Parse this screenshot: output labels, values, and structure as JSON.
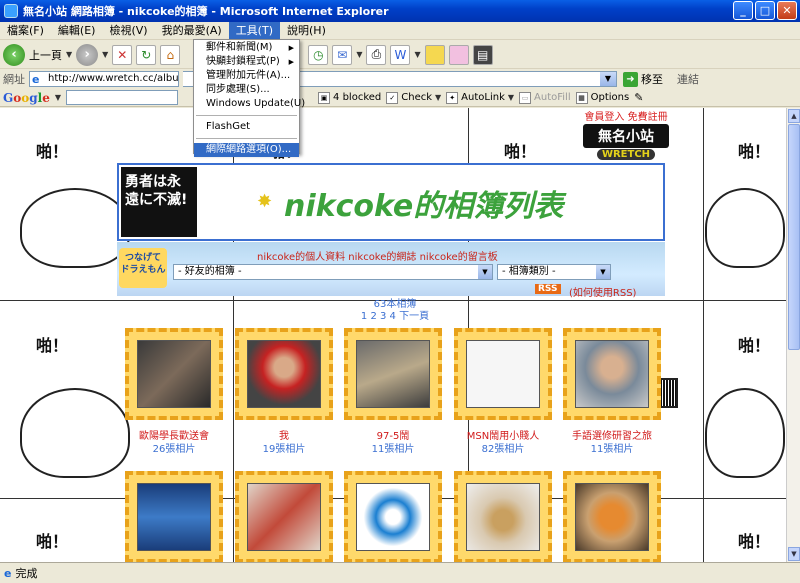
{
  "window": {
    "title": "無名小站 網路相簿 - nikcoke的相簿 - Microsoft Internet Explorer"
  },
  "menu": [
    "檔案(F)",
    "編輯(E)",
    "檢視(V)",
    "我的最愛(A)",
    "工具(T)",
    "說明(H)"
  ],
  "toolbar": {
    "back_label": "上一頁"
  },
  "address": {
    "label": "網址",
    "url": "http://www.wretch.cc/album/nikcoke",
    "go_label": "移至",
    "links_label": "連結"
  },
  "google_bar": {
    "logo": "Google",
    "blocked": "4 blocked",
    "check": "Check",
    "autolink": "AutoLink",
    "autofill": "AutoFill",
    "options": "Options"
  },
  "tools_menu": {
    "items": [
      "郵件和新聞(M)",
      "快顯封鎖程式(P)",
      "管理附加元件(A)...",
      "同步處理(S)...",
      "Windows Update(U)"
    ],
    "flashget": "FlashGet",
    "internet_options": "網際網路選項(O)..."
  },
  "page": {
    "papa": "啪！",
    "brand": {
      "top": "會員登入 免費註冊",
      "main": "無名小站",
      "sub": "WRETCH"
    },
    "banner_logo": "勇者は永遠に不滅!",
    "banner_title": "nikcoke的相簿列表",
    "nav_links": "nikcoke的個人資料  nikcoke的網誌  nikcoke的留言板",
    "nav_logo": "つなげて ドラえもん",
    "select_friend": "- 好友的相簿 -",
    "select_category": "- 相簿類別 -",
    "rss": "RSS",
    "rss_howto": "(如何使用RSS)",
    "album_count": "63本相簿",
    "pager": "1 2 3 4 下一頁",
    "albums": [
      {
        "title": "歐陽學長歡送會",
        "count": "26張相片"
      },
      {
        "title": "我",
        "count": "19張相片"
      },
      {
        "title": "97-5鬧",
        "count": "11張相片"
      },
      {
        "title": "MSN鬧用小賤人",
        "count": "82張相片"
      },
      {
        "title": "手語選修研習之旅",
        "count": "11張相片"
      }
    ]
  },
  "status": {
    "text": "完成"
  }
}
